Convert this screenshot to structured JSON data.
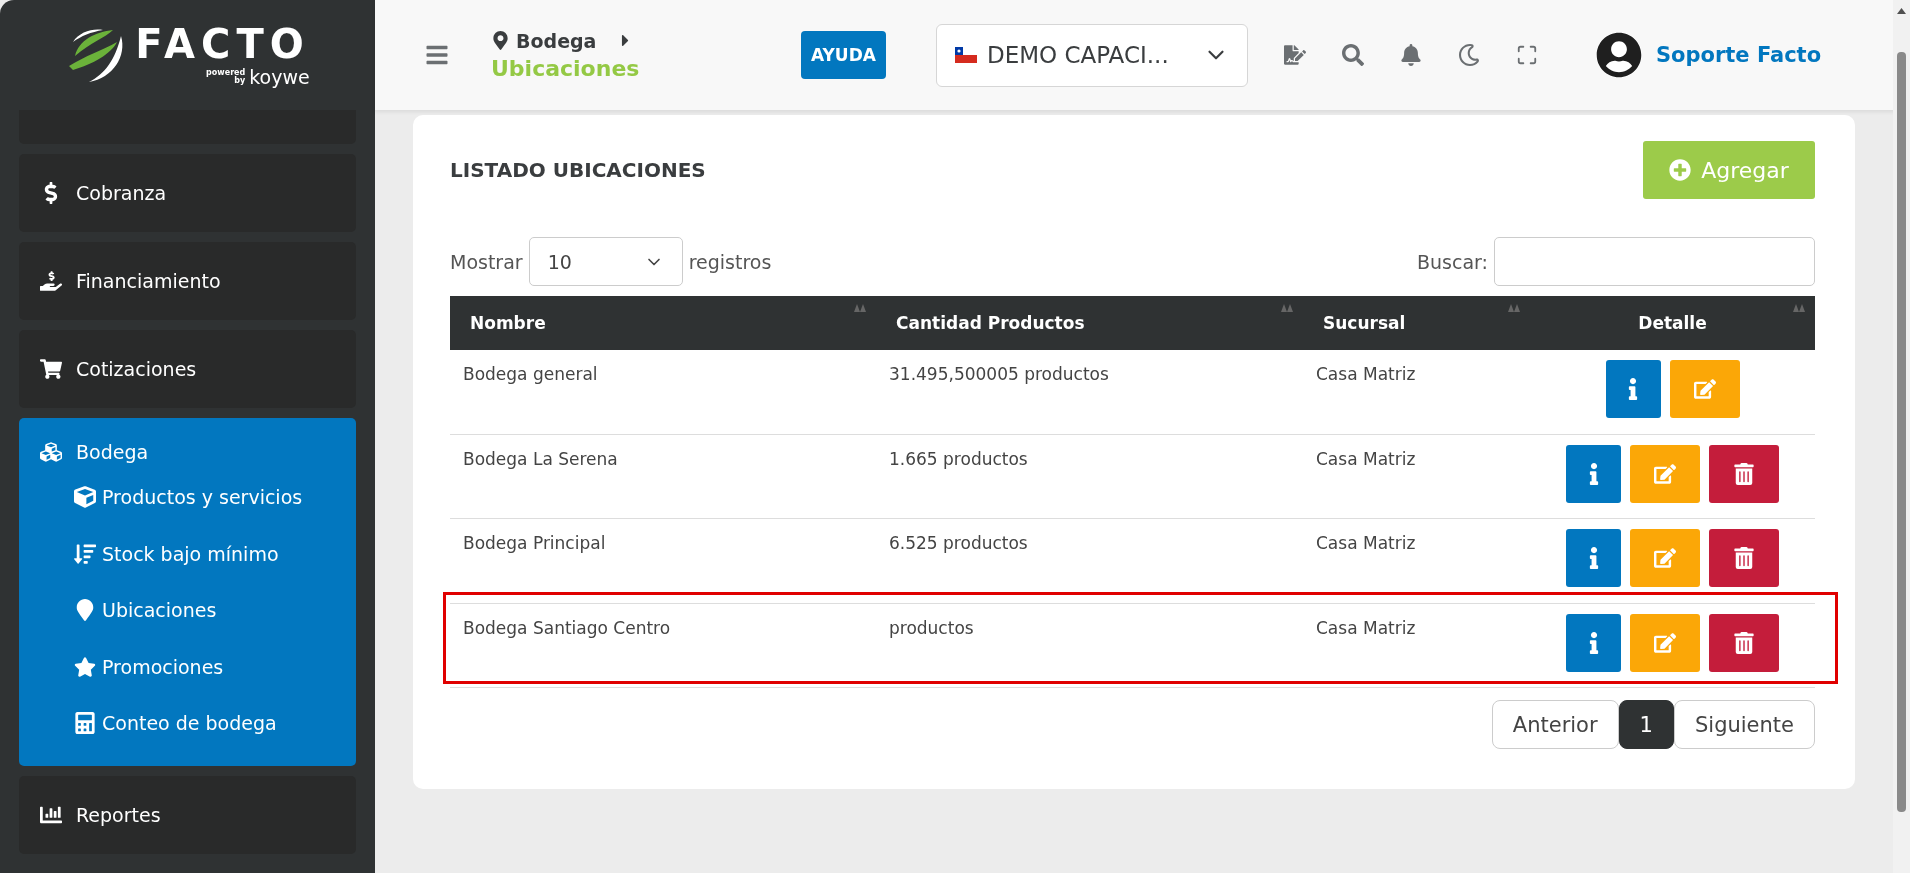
{
  "logo": {
    "wordmark": "FACTO",
    "tagline": "powered by",
    "brand": "koywe"
  },
  "sidebar": {
    "items": [
      {
        "label": "Cobranza",
        "expanded": false
      },
      {
        "label": "Financiamiento",
        "expanded": false
      },
      {
        "label": "Cotizaciones",
        "expanded": false
      },
      {
        "label": "Bodega",
        "expanded": true,
        "children": [
          {
            "label": "Productos y servicios"
          },
          {
            "label": "Stock bajo mínimo"
          },
          {
            "label": "Ubicaciones"
          },
          {
            "label": "Promociones"
          },
          {
            "label": "Conteo de bodega"
          }
        ]
      },
      {
        "label": "Reportes",
        "expanded": false
      }
    ]
  },
  "header": {
    "breadcrumb": {
      "parent": "Bodega",
      "current": "Ubicaciones"
    },
    "help_button": "AYUDA",
    "company_select": {
      "value": "DEMO CAPACI..."
    },
    "user": "Soporte Facto"
  },
  "panel": {
    "title": "LISTADO UBICACIONES",
    "add_button": "Agregar",
    "length": {
      "prefix": "Mostrar",
      "value": "10",
      "suffix": "registros"
    },
    "search": {
      "label": "Buscar:"
    },
    "table": {
      "columns": [
        "Nombre",
        "Cantidad Productos",
        "Sucursal",
        "Detalle"
      ],
      "rows": [
        {
          "cells": [
            "Bodega general",
            "31.495,500005 productos",
            "Casa Matriz"
          ],
          "deletable": false,
          "highlighted": false
        },
        {
          "cells": [
            "Bodega La Serena",
            "1.665 productos",
            "Casa Matriz"
          ],
          "deletable": true,
          "highlighted": false
        },
        {
          "cells": [
            "Bodega Principal",
            "6.525 productos",
            "Casa Matriz"
          ],
          "deletable": true,
          "highlighted": false
        },
        {
          "cells": [
            "Bodega Santiago Centro",
            "productos",
            "Casa Matriz"
          ],
          "deletable": true,
          "highlighted": true
        }
      ]
    },
    "pagination": [
      {
        "label": "Anterior",
        "selected": false
      },
      {
        "label": "1",
        "selected": true
      },
      {
        "label": "Siguiente",
        "selected": false
      }
    ]
  }
}
